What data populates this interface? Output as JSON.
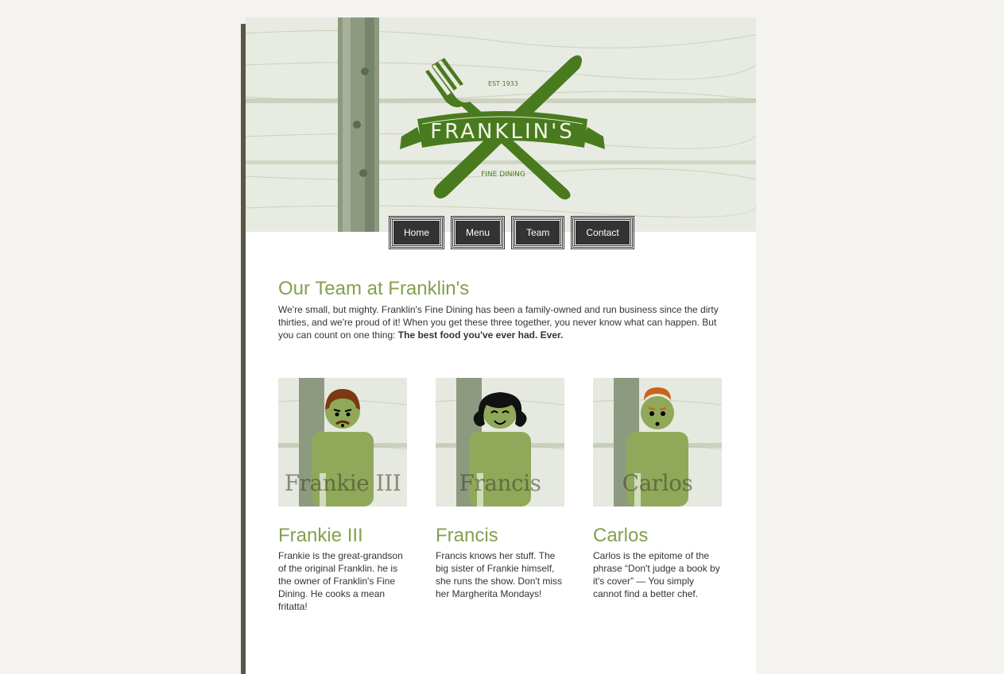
{
  "header": {
    "logo_name": "FRANKLIN'S",
    "logo_est": "EST·1933",
    "logo_tagline": "FINE DINING",
    "logo_icon": "fork-knife-crossed-icon"
  },
  "nav": {
    "items": [
      {
        "label": "Home"
      },
      {
        "label": "Menu"
      },
      {
        "label": "Team"
      },
      {
        "label": "Contact"
      }
    ]
  },
  "intro": {
    "title": "Our Team at Franklin's",
    "text": "We're small, but mighty. Franklin's Fine Dining has been a family-owned and run business since the dirty thirties, and we're proud of it! When you get these three together, you never know what can happen. But you can count on one thing: ",
    "emphasis": "The best food you've ever had. Ever."
  },
  "team": [
    {
      "caption": "Frankie III",
      "name": "Frankie III",
      "bio": "Frankie is the great-grandson of the original Franklin. he is the owner of Franklin's Fine Dining. He cooks a mean fritatta!"
    },
    {
      "caption": "Francis",
      "name": "Francis",
      "bio": "Francis knows her stuff. The big sister of Frankie himself, she runs the show. Don't miss her Margherita Mondays!"
    },
    {
      "caption": "Carlos",
      "name": "Carlos",
      "bio": "Carlos is the epitome of the phrase “Don't judge a book by it's cover” — You simply cannot find a better chef."
    }
  ],
  "colors": {
    "accent": "#85a04e",
    "logo_green": "#4a7a1e",
    "nav_bg": "#333333",
    "figure_green": "#90a85a"
  }
}
